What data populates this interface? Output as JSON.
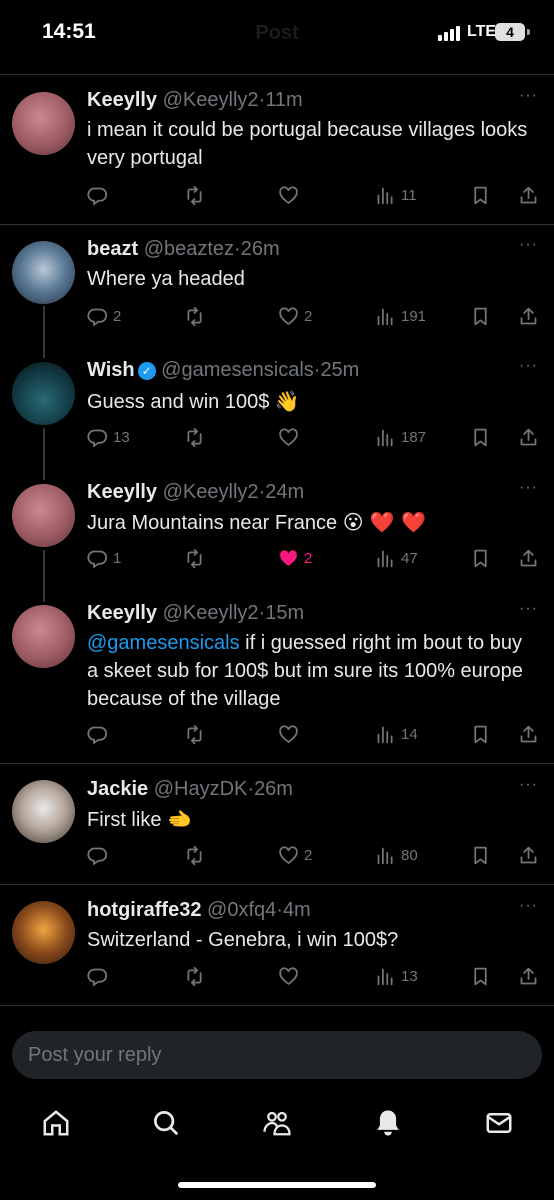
{
  "status_bar": {
    "time": "14:51",
    "title": "Post",
    "network": "LTE",
    "battery": "4"
  },
  "tweets": [
    {
      "name": "Keeylly",
      "handle": "@Keeylly2",
      "time": "11m",
      "verified": false,
      "text": "i mean it could be portugal because villages looks very portugal",
      "mention": "",
      "emoji": "",
      "reply_count": "",
      "like_count": "",
      "liked": false,
      "views": "11"
    },
    {
      "name": "beazt",
      "handle": "@beaztez",
      "time": "26m",
      "verified": false,
      "text": "Where ya headed",
      "mention": "",
      "emoji": "",
      "reply_count": "2",
      "like_count": "2",
      "liked": false,
      "views": "191"
    },
    {
      "name": "Wish",
      "handle": "@gamesensicals",
      "time": "25m",
      "verified": true,
      "text": "Guess and win 100$",
      "mention": "",
      "emoji": "👋",
      "reply_count": "13",
      "like_count": "",
      "liked": false,
      "views": "187"
    },
    {
      "name": "Keeylly",
      "handle": "@Keeylly2",
      "time": "24m",
      "verified": false,
      "text": "Jura Mountains near France",
      "mention": "",
      "emoji": "😮 ❤️ ❤️",
      "reply_count": "1",
      "like_count": "2",
      "liked": true,
      "views": "47"
    },
    {
      "name": "Keeylly",
      "handle": "@Keeylly2",
      "time": "15m",
      "verified": false,
      "text": "if i guessed right im bout to buy a skeet sub for 100$ but im sure its 100% europe because of the village",
      "mention": "@gamesensicals",
      "emoji": "",
      "reply_count": "",
      "like_count": "",
      "liked": false,
      "views": "14"
    },
    {
      "name": "Jackie",
      "handle": "@HayzDK",
      "time": "26m",
      "verified": false,
      "text": "First like",
      "mention": "",
      "emoji": "🫲",
      "reply_count": "",
      "like_count": "2",
      "liked": false,
      "views": "80"
    },
    {
      "name": "hotgiraffe32",
      "handle": "@0xfq4",
      "time": "4m",
      "verified": false,
      "text": "Switzerland - Genebra, i win 100$?",
      "mention": "",
      "emoji": "",
      "reply_count": "",
      "like_count": "",
      "liked": false,
      "views": "13"
    }
  ],
  "reply_box": {
    "placeholder": "Post your reply"
  },
  "nav": [
    "home-icon",
    "search-icon",
    "communities-icon",
    "notifications-icon",
    "messages-icon"
  ],
  "colors": {
    "accent": "#1d9bf0",
    "like": "#f91880",
    "muted": "#71767b",
    "background": "#000000"
  }
}
